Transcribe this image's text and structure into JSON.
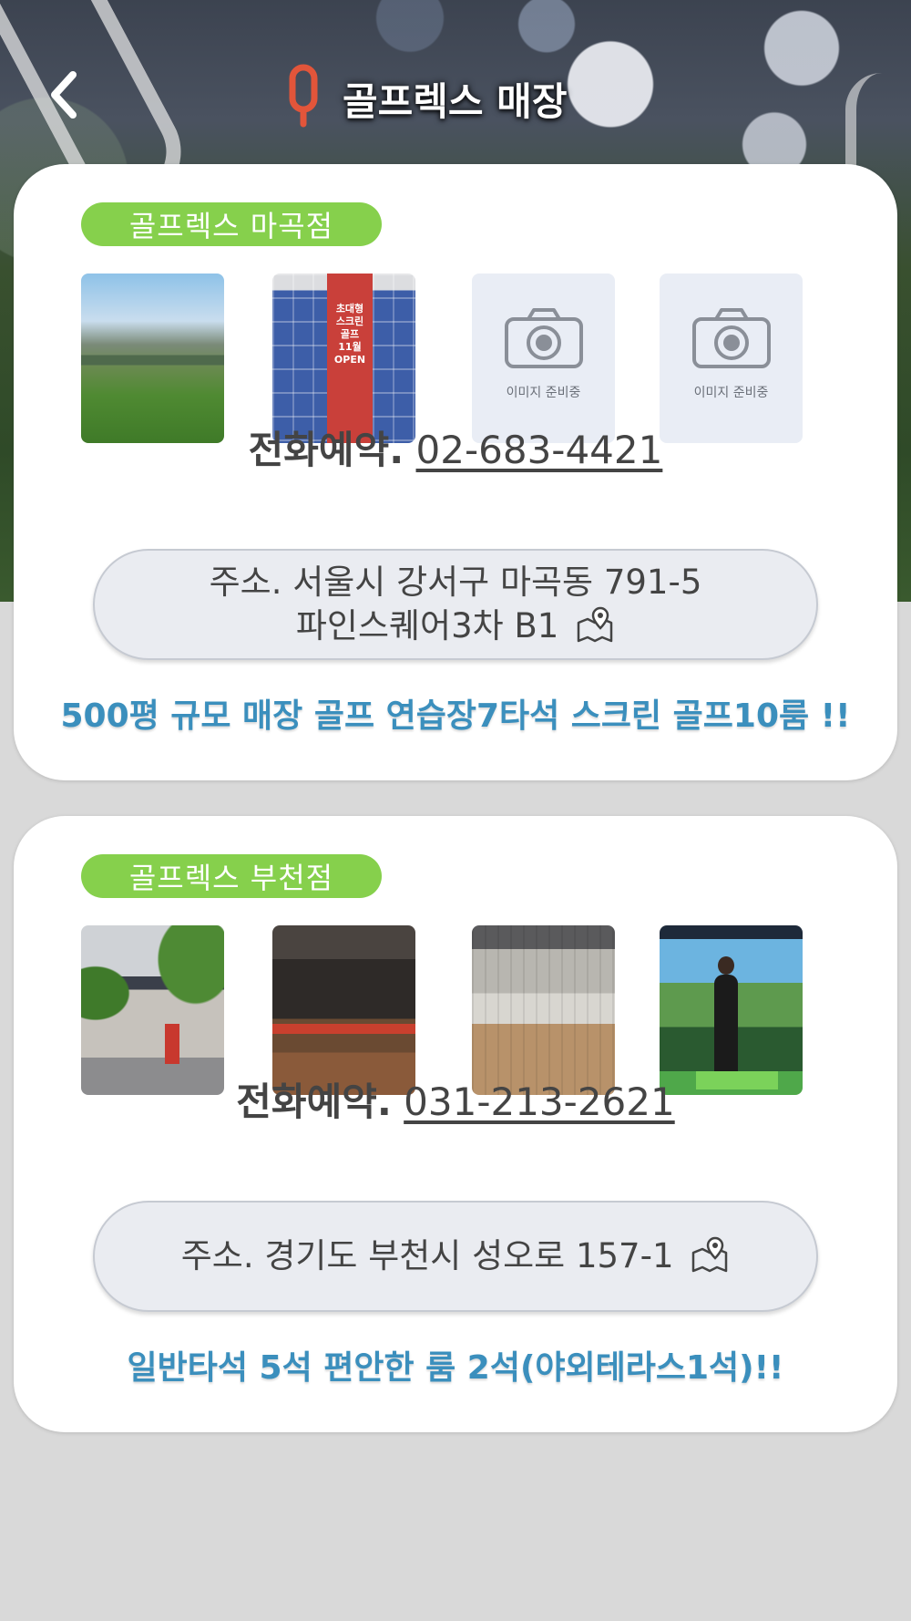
{
  "header": {
    "title": "골프렉스 매장",
    "back_icon": "chevron-left-icon",
    "logo_icon": "golfrex-logo-icon",
    "logo_color": "#e2553a"
  },
  "colors": {
    "badge": "#86d04c",
    "features_text": "#3b8fbd",
    "address_pill": "#eaecf1",
    "page_background": "#d9d9d9"
  },
  "stores": [
    {
      "badge": "골프렉스 마곡점",
      "photos": [
        {
          "type": "image",
          "content": "golf-course-photo"
        },
        {
          "type": "image",
          "content": "building-with-banner-photo",
          "banner_lines": [
            "초대형",
            "스크린",
            "골프",
            "11월",
            "OPEN"
          ]
        },
        {
          "type": "placeholder",
          "icon": "camera-icon",
          "label": "이미지 준비중"
        },
        {
          "type": "placeholder",
          "icon": "camera-icon",
          "label": "이미지 준비중"
        }
      ],
      "phone_label": "전화예약.",
      "phone_number": "02-683-4421",
      "address_line1": "주소. 서울시 강서구 마곡동 791-5",
      "address_line2": "파인스퀘어3차 B1",
      "address_icon": "map-pin-icon",
      "features": "500평 규모 매장  골프 연습장7타석  스크린 골프10룸 !!"
    },
    {
      "badge": "골프렉스 부천점",
      "photos": [
        {
          "type": "image",
          "content": "entrance-photo"
        },
        {
          "type": "image",
          "content": "lounge-photo"
        },
        {
          "type": "image",
          "content": "terrace-photo"
        },
        {
          "type": "image",
          "content": "screen-golf-room-photo"
        }
      ],
      "phone_label": "전화예약.",
      "phone_number": "031-213-2621",
      "address_line1": "주소. 경기도 부천시 성오로 157-1",
      "address_icon": "map-pin-icon",
      "features": "일반타석 5석  편안한 룸 2석(야외테라스1석)!!"
    }
  ]
}
